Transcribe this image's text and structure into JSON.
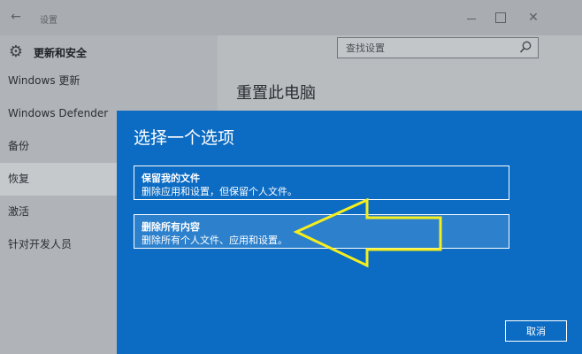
{
  "window": {
    "title": "设置",
    "back_glyph": "←",
    "close_glyph": "✕"
  },
  "sidebar": {
    "header": "更新和安全",
    "items": [
      {
        "label": "Windows 更新"
      },
      {
        "label": "Windows Defender"
      },
      {
        "label": "备份"
      },
      {
        "label": "恢复",
        "selected": true
      },
      {
        "label": "激活"
      },
      {
        "label": "针对开发人员"
      }
    ]
  },
  "search": {
    "placeholder": "查找设置"
  },
  "main": {
    "title": "重置此电脑"
  },
  "dialog": {
    "title": "选择一个选项",
    "options": [
      {
        "title": "保留我的文件",
        "desc": "删除应用和设置，但保留个人文件。"
      },
      {
        "title": "删除所有内容",
        "desc": "删除所有个人文件、应用和设置。"
      }
    ],
    "cancel_label": "取消"
  },
  "colors": {
    "dialog_bg": "#0c6bc2",
    "annotation_arrow": "#f5ee1e"
  },
  "icons": [
    "back-arrow-icon",
    "gear-icon",
    "search-icon",
    "minimize-icon",
    "maximize-icon",
    "close-icon",
    "annotation-arrow-icon"
  ]
}
